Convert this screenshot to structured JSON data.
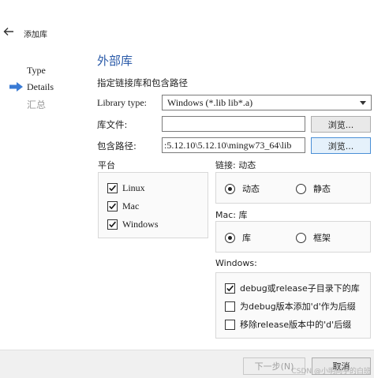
{
  "header": {
    "title": "添加库"
  },
  "steps": [
    {
      "label": "Type"
    },
    {
      "label": "Details"
    },
    {
      "label": "汇总"
    }
  ],
  "page": {
    "title": "外部库",
    "subtitle": "指定链接库和包含路径"
  },
  "form": {
    "library_type_label": "Library type:",
    "library_type_value": "Windows (*.lib lib*.a)",
    "library_file_label": "库文件:",
    "library_file_value": "",
    "include_path_label": "包含路径:",
    "include_path_value": ":5.12.10\\5.12.10\\mingw73_64\\lib",
    "browse_label": "浏览..."
  },
  "platform": {
    "title": "平台",
    "items": [
      {
        "label": "Linux",
        "checked": true
      },
      {
        "label": "Mac",
        "checked": true
      },
      {
        "label": "Windows",
        "checked": true
      }
    ]
  },
  "linkage": {
    "title": "链接: 动态",
    "options": [
      {
        "label": "动态",
        "selected": true
      },
      {
        "label": "静态",
        "selected": false
      }
    ]
  },
  "mac": {
    "title": "Mac: 库",
    "options": [
      {
        "label": "库",
        "selected": true
      },
      {
        "label": "框架",
        "selected": false
      }
    ]
  },
  "windows": {
    "title": "Windows:",
    "items": [
      {
        "label": "debug或release子目录下的库",
        "checked": true
      },
      {
        "label": "为debug版本添加'd'作为后缀",
        "checked": false
      },
      {
        "label": "移除release版本中的'd'后缀",
        "checked": false
      }
    ]
  },
  "footer": {
    "next_label": "下一步(N)",
    "cancel_label": "取消",
    "watermark": "CSDN @小明同学的白班"
  },
  "colors": {
    "accent": "#2a5aa8",
    "step_arrow": "#3a7bd5"
  }
}
